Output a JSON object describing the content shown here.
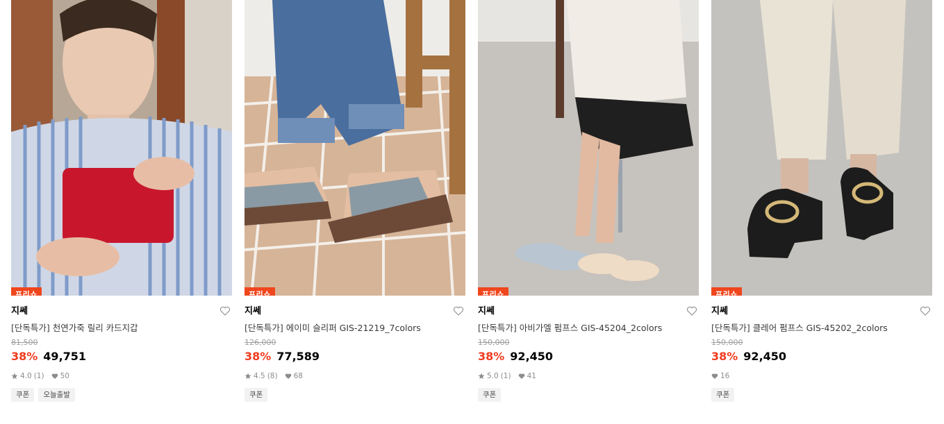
{
  "accent_color": "#f03c1f",
  "badge_color": "#f0461e",
  "products": [
    {
      "badge": "프리쇼",
      "brand": "지쎄",
      "name": "[단독특가] 천연가죽 릴리 카드지갑",
      "original_price": "81,500",
      "discount": "38%",
      "price": "49,751",
      "rating": "4.0",
      "review_count": "(1)",
      "likes": "50",
      "tags": [
        "쿠폰",
        "오늘출발"
      ],
      "image": "woman-holding-red-card-wallet"
    },
    {
      "badge": "프리쇼",
      "brand": "지쎄",
      "name": "[단독특가] 에이미 슬리퍼 GIS-21219_7colors",
      "original_price": "126,000",
      "discount": "38%",
      "price": "77,589",
      "rating": "4.5",
      "review_count": "(8)",
      "likes": "68",
      "tags": [
        "쿠폰"
      ],
      "image": "grey-wedge-slippers-on-tile"
    },
    {
      "badge": "프리쇼",
      "brand": "지쎄",
      "name": "[단독특가] 아비가엘 펌프스 GIS-45204_2colors",
      "original_price": "150,000",
      "discount": "38%",
      "price": "92,450",
      "rating": "5.0",
      "review_count": "(1)",
      "likes": "41",
      "tags": [
        "쿠폰"
      ],
      "image": "woman-seated-with-pumps"
    },
    {
      "badge": "프리쇼",
      "brand": "지쎄",
      "name": "[단독특가] 클레어 펌프스 GIS-45202_2colors",
      "original_price": "150,000",
      "discount": "38%",
      "price": "92,450",
      "likes": "16",
      "tags": [
        "쿠폰"
      ],
      "image": "black-patent-loafers"
    }
  ]
}
